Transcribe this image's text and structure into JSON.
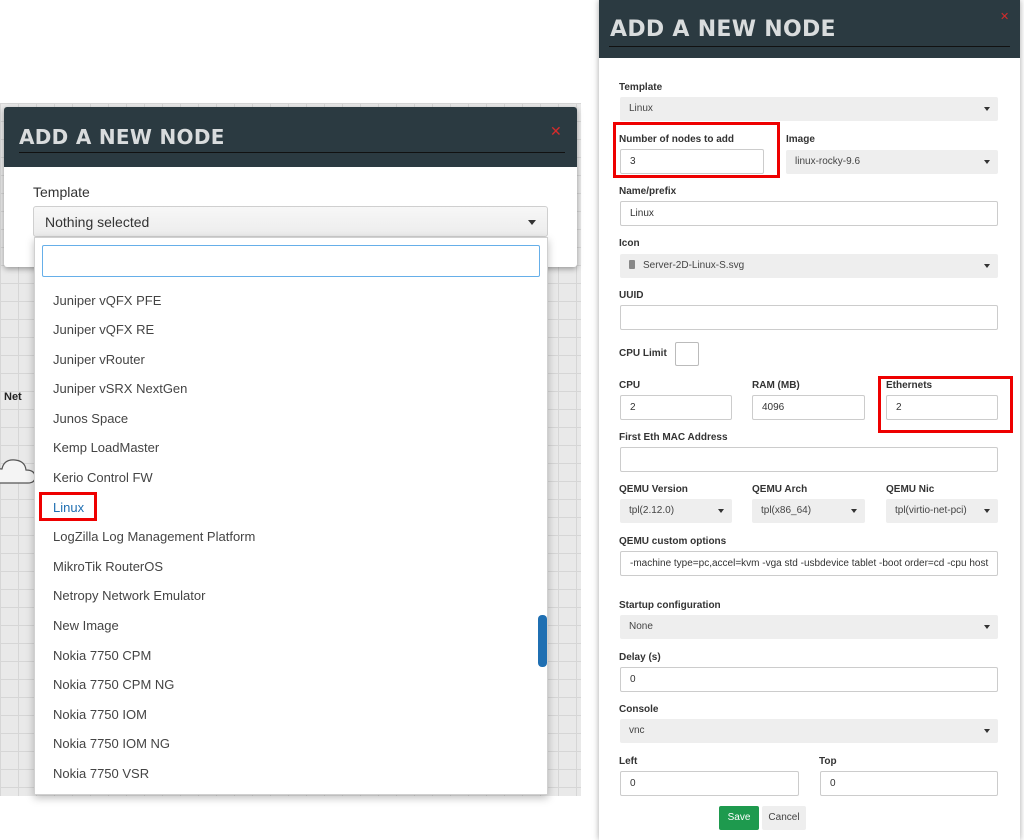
{
  "left_dialog": {
    "title": "ADD A NEW NODE",
    "close_glyph": "✕",
    "template_label": "Template",
    "template_selected": "Nothing selected",
    "search_value": "",
    "items": [
      "Juniper vQFX PFE",
      "Juniper vQFX RE",
      "Juniper vRouter",
      "Juniper vSRX NextGen",
      "Junos Space",
      "Kemp LoadMaster",
      "Kerio Control FW",
      "Linux",
      "LogZilla Log Management Platform",
      "MikroTik RouterOS",
      "Netropy Network Emulator",
      "New Image",
      "Nokia 7750 CPM",
      "Nokia 7750 CPM NG",
      "Nokia 7750 IOM",
      "Nokia 7750 IOM NG",
      "Nokia 7750 VSR"
    ],
    "highlighted_item": "Linux",
    "canvas_node_label": "Net"
  },
  "right_dialog": {
    "title": "ADD A NEW NODE",
    "close_glyph": "✕",
    "template_label": "Template",
    "template_value": "Linux",
    "num_nodes_label": "Number of nodes to add",
    "num_nodes_value": "3",
    "image_label": "Image",
    "image_value": "linux-rocky-9.6",
    "name_label": "Name/prefix",
    "name_value": "Linux",
    "icon_label": "Icon",
    "icon_value": "Server-2D-Linux-S.svg",
    "uuid_label": "UUID",
    "uuid_value": "",
    "cpu_limit_label": "CPU Limit",
    "cpu_label": "CPU",
    "cpu_value": "2",
    "ram_label": "RAM (MB)",
    "ram_value": "4096",
    "ethernets_label": "Ethernets",
    "ethernets_value": "2",
    "mac_label": "First Eth MAC Address",
    "mac_value": "",
    "qemu_version_label": "QEMU Version",
    "qemu_version_value": "tpl(2.12.0)",
    "qemu_arch_label": "QEMU Arch",
    "qemu_arch_value": "tpl(x86_64)",
    "qemu_nic_label": "QEMU Nic",
    "qemu_nic_value": "tpl(virtio-net-pci)",
    "qemu_custom_label": "QEMU custom options",
    "qemu_custom_value": "-machine type=pc,accel=kvm -vga std -usbdevice tablet -boot order=cd -cpu host",
    "startup_label": "Startup configuration",
    "startup_value": "None",
    "delay_label": "Delay (s)",
    "delay_value": "0",
    "console_label": "Console",
    "console_value": "vnc",
    "left_label": "Left",
    "left_value": "0",
    "top_label": "Top",
    "top_value": "0",
    "save_label": "Save",
    "cancel_label": "Cancel"
  },
  "colors": {
    "header_bg": "#2b3a41",
    "highlight_red": "#ee0000",
    "save_green": "#1e9a4e",
    "link_blue": "#1f6fb2"
  }
}
